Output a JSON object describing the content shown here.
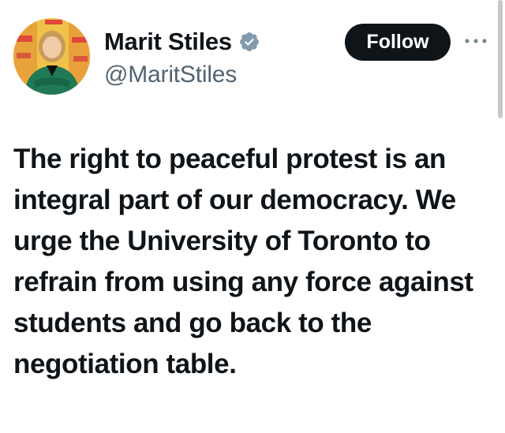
{
  "user": {
    "display_name": "Marit Stiles",
    "handle": "@MaritStiles",
    "verified_icon": "verified-badge-icon",
    "avatar_icon": "profile-photo"
  },
  "actions": {
    "follow_label": "Follow",
    "more_icon": "more-options-icon"
  },
  "tweet": {
    "text": "The right to peaceful protest is an integral part of our democracy. We urge the University of Toronto to refrain from using any force against students and go back to the negotiation table."
  },
  "colors": {
    "text": "#0f1419",
    "secondary": "#536471",
    "verified": "#829aab",
    "button_bg": "#0f1419",
    "button_text": "#ffffff"
  }
}
